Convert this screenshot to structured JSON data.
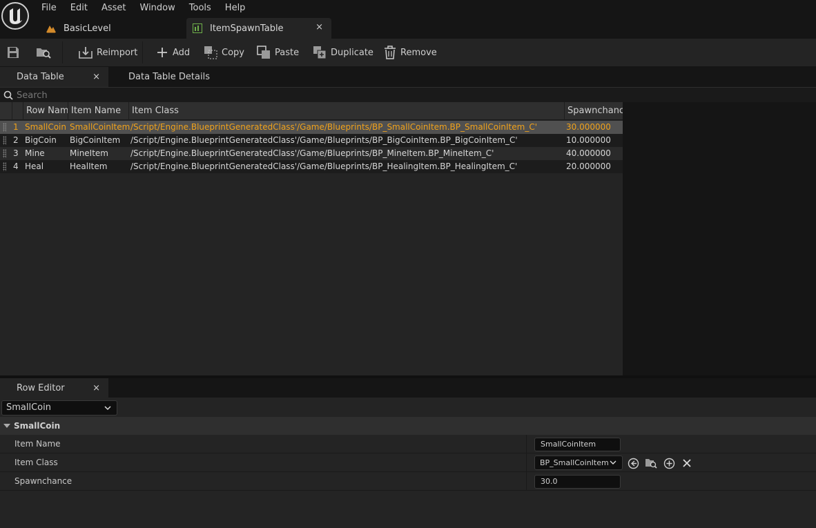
{
  "menu": [
    "File",
    "Edit",
    "Asset",
    "Window",
    "Tools",
    "Help"
  ],
  "doc_tabs": {
    "level": "BasicLevel",
    "table": "ItemSpawnTable"
  },
  "toolbar": {
    "reimport": "Reimport",
    "add": "Add",
    "copy": "Copy",
    "paste": "Paste",
    "duplicate": "Duplicate",
    "remove": "Remove"
  },
  "panel_tabs": {
    "data_table": "Data Table",
    "details": "Data Table Details",
    "close": "×"
  },
  "search": {
    "placeholder": "Search"
  },
  "table": {
    "columns": [
      "Row Name",
      "Item Name",
      "Item Class",
      "Spawnchance"
    ],
    "rows": [
      {
        "index": "1",
        "row_name": "SmallCoin",
        "item_name": "SmallCoinItem",
        "item_class": "/Script/Engine.BlueprintGeneratedClass'/Game/Blueprints/BP_SmallCoinItem.BP_SmallCoinItem_C'",
        "spawnchance": "30.000000"
      },
      {
        "index": "2",
        "row_name": "BigCoin",
        "item_name": "BigCoinItem",
        "item_class": "/Script/Engine.BlueprintGeneratedClass'/Game/Blueprints/BP_BigCoinItem.BP_BigCoinItem_C'",
        "spawnchance": "10.000000"
      },
      {
        "index": "3",
        "row_name": "Mine",
        "item_name": "MineItem",
        "item_class": "/Script/Engine.BlueprintGeneratedClass'/Game/Blueprints/BP_MineItem.BP_MineItem_C'",
        "spawnchance": "40.000000"
      },
      {
        "index": "4",
        "row_name": "Heal",
        "item_name": "HealItem",
        "item_class": "/Script/Engine.BlueprintGeneratedClass'/Game/Blueprints/BP_HealingItem.BP_HealingItem_C'",
        "spawnchance": "20.000000"
      }
    ],
    "selected_row": 0
  },
  "row_editor": {
    "tab": "Row Editor",
    "selected": "SmallCoin",
    "category": "SmallCoin",
    "props": {
      "item_name_label": "Item Name",
      "item_name_value": "SmallCoinItem",
      "item_class_label": "Item Class",
      "item_class_value": "BP_SmallCoinItem",
      "spawnchance_label": "Spawnchance",
      "spawnchance_value": "30.0"
    }
  },
  "colors": {
    "selected_text": "#f0a21b",
    "panel": "#242424",
    "background": "#151515"
  }
}
